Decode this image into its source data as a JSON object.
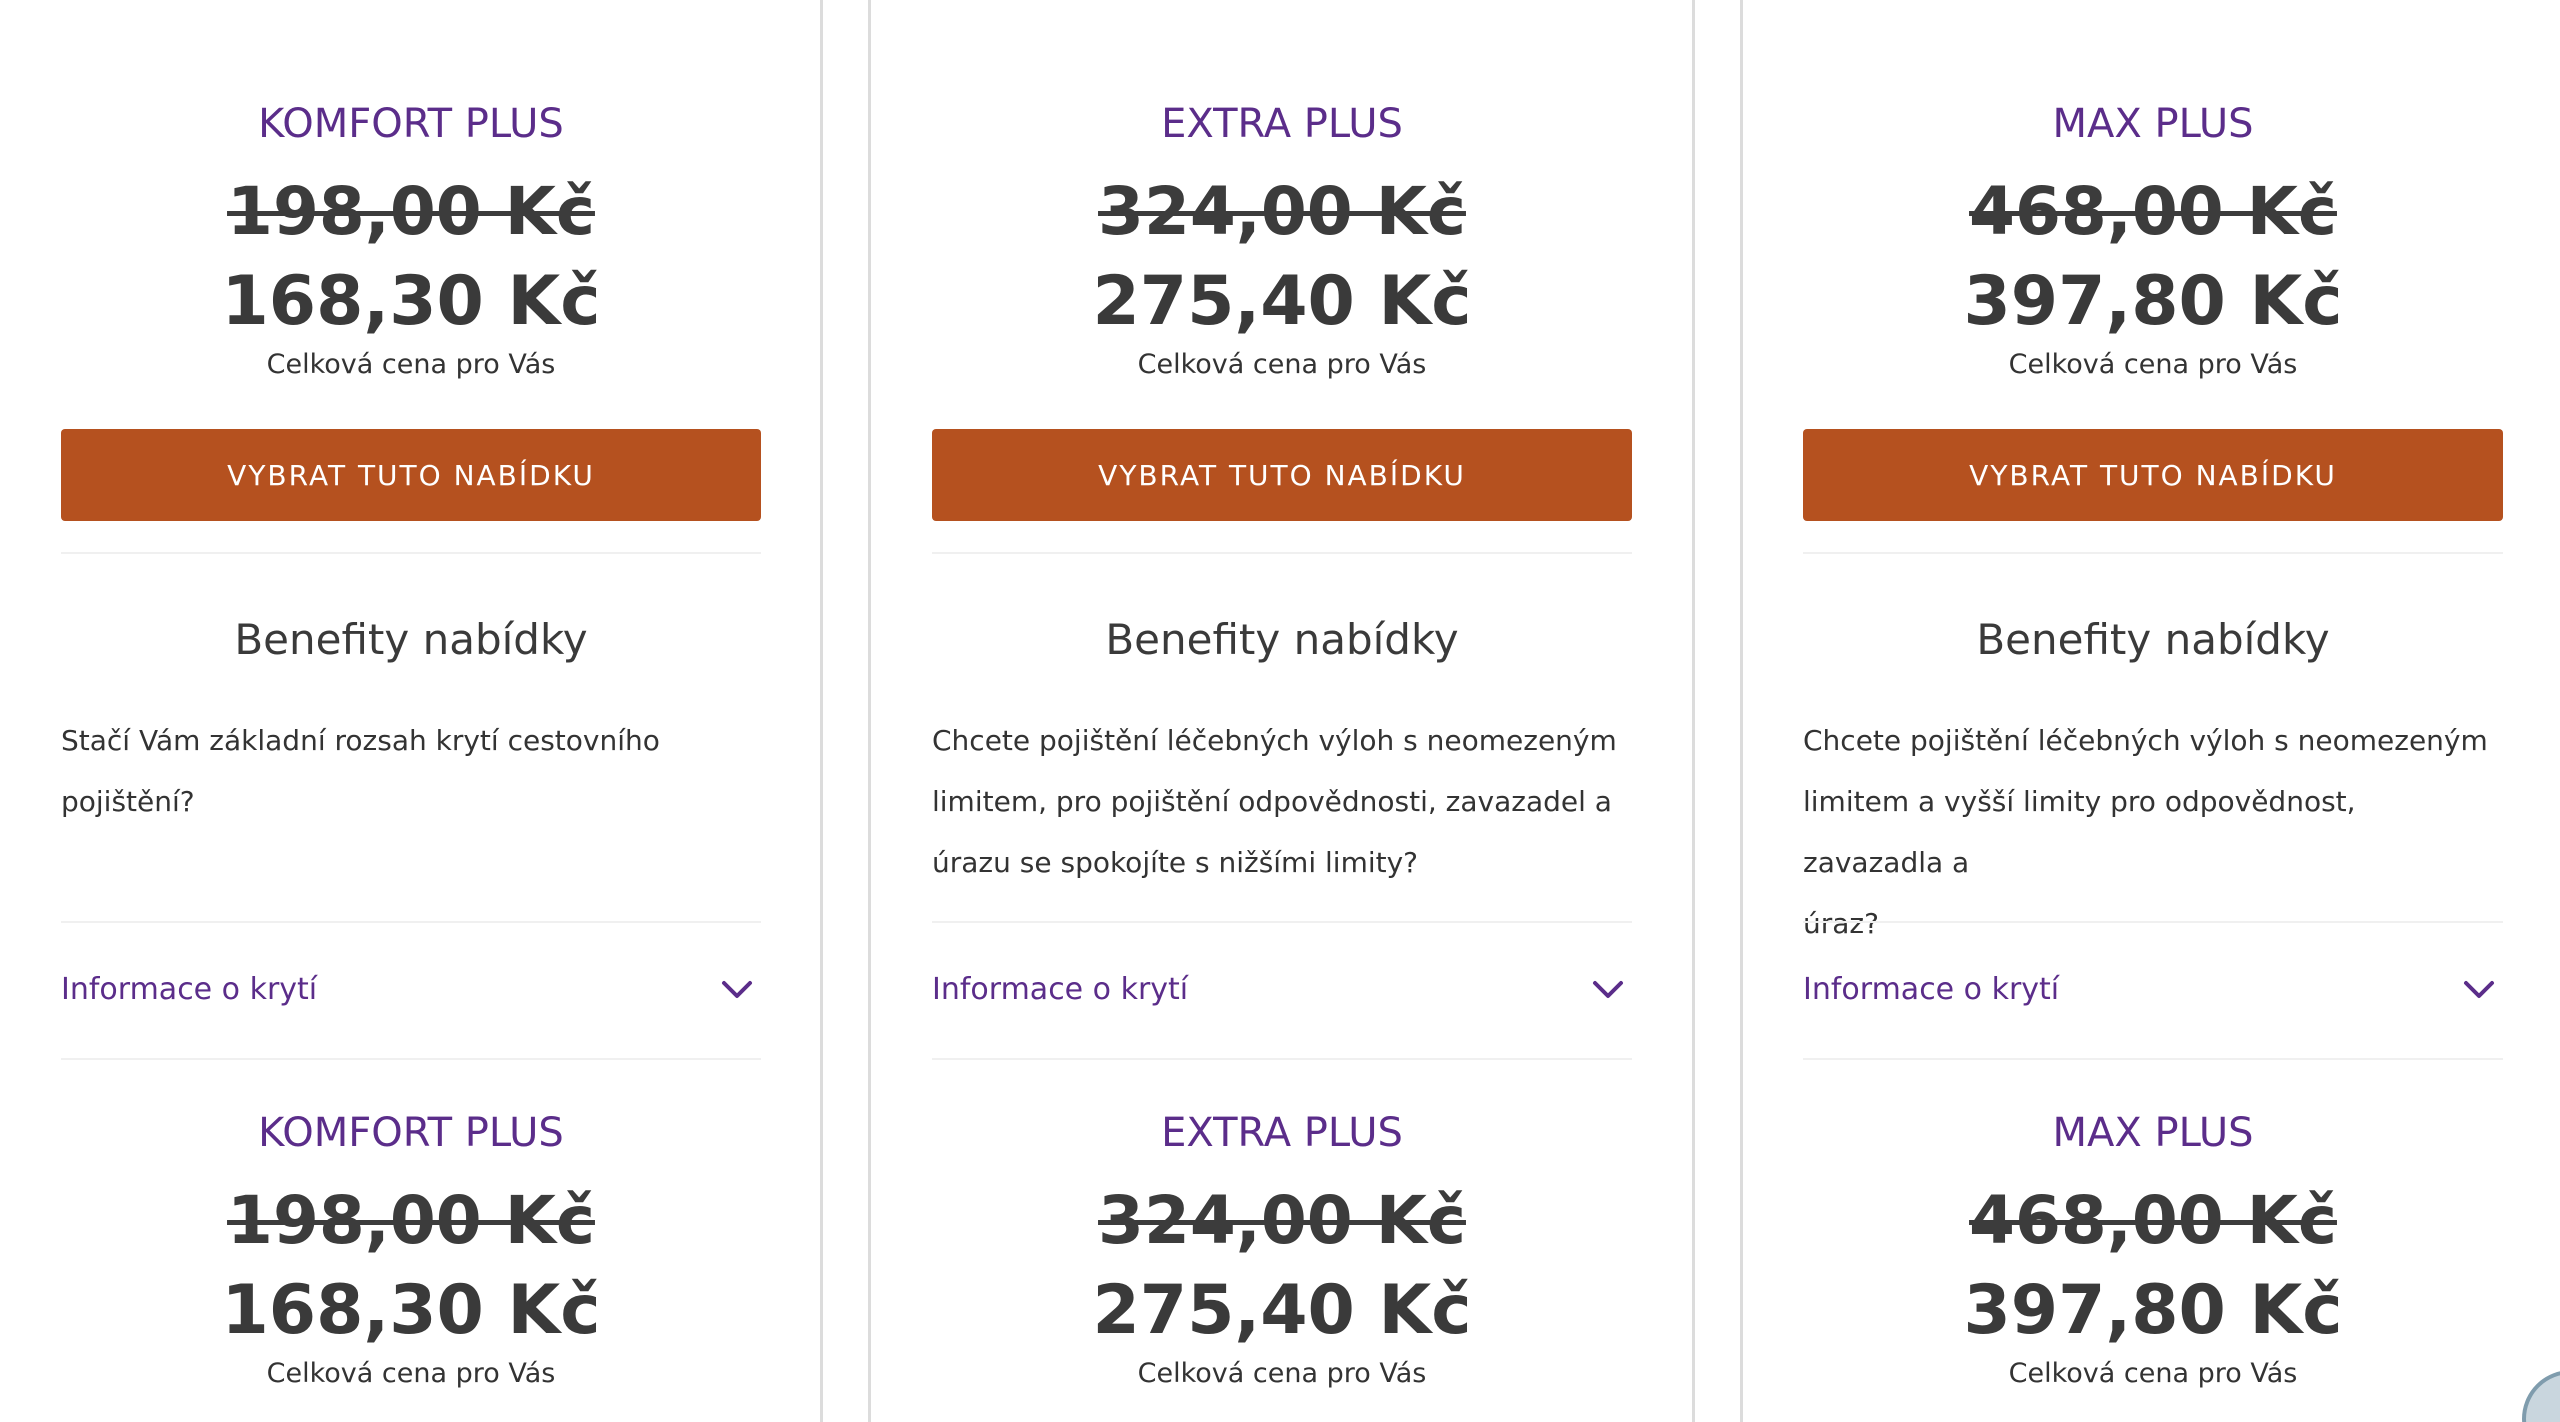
{
  "plans": [
    {
      "name": "KOMFORT PLUS",
      "old_price": "198,00 Kč",
      "new_price": "168,30 Kč",
      "price_caption": "Celková cena pro Vás",
      "button_label": "VYBRAT TUTO NABÍDKU",
      "benefits_title": "Benefity nabídky",
      "benefits_lines": [
        "Stačí Vám základní rozsah krytí cestovního pojištění?"
      ],
      "accordion_label": "Informace o krytí"
    },
    {
      "name": "EXTRA PLUS",
      "old_price": "324,00 Kč",
      "new_price": "275,40 Kč",
      "price_caption": "Celková cena pro Vás",
      "button_label": "VYBRAT TUTO NABÍDKU",
      "benefits_title": "Benefity nabídky",
      "benefits_lines": [
        "Chcete pojištění léčebných výloh s neomezeným",
        "limitem, pro pojištění odpovědnosti, zavazadel a",
        "úrazu se spokojíte s nižšími limity?"
      ],
      "accordion_label": "Informace o krytí"
    },
    {
      "name": "MAX PLUS",
      "old_price": "468,00 Kč",
      "new_price": "397,80 Kč",
      "price_caption": "Celková cena pro Vás",
      "button_label": "VYBRAT TUTO NABÍDKU",
      "benefits_title": "Benefity nabídky",
      "benefits_lines": [
        "Chcete pojištění léčebných výloh s neomezeným",
        "limitem a vyšší limity pro odpovědnost, zavazadla a",
        "úraz?"
      ],
      "accordion_label": "Informace o krytí"
    }
  ],
  "colors": {
    "brand_purple": "#5b2d8a",
    "button_orange": "#b5511f"
  },
  "icons": {
    "accordion_toggle": "chevron-down-icon"
  }
}
